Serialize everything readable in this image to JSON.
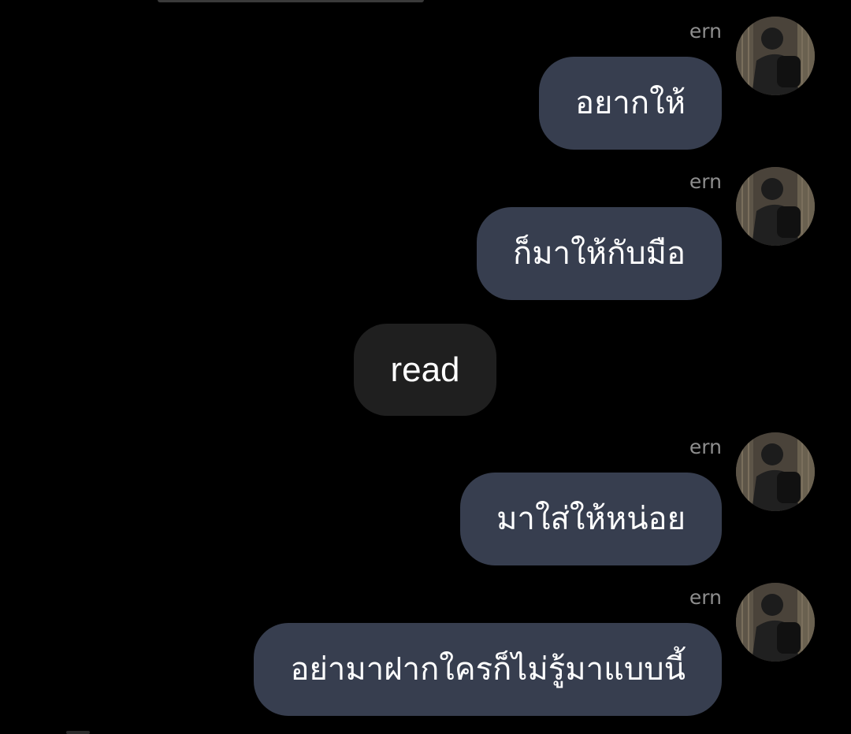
{
  "messages": [
    {
      "sender": "ern",
      "text": "อยากให้",
      "avatar": "user-photo"
    },
    {
      "sender": "ern",
      "text": "ก็มาให้กับมือ",
      "avatar": "user-photo"
    },
    {
      "sender": "ern",
      "text": "มาใส่ให้หน่อย",
      "avatar": "user-photo"
    },
    {
      "sender": "ern",
      "text": "อย่ามาฝากใครก็ไม่รู้มาแบบนี้",
      "avatar": "user-photo"
    }
  ],
  "read_receipt": "read",
  "colors": {
    "background": "#000000",
    "bubble": "#373e4f",
    "read_pill": "#1f1f1f",
    "sender_name": "#8e8e8e"
  }
}
